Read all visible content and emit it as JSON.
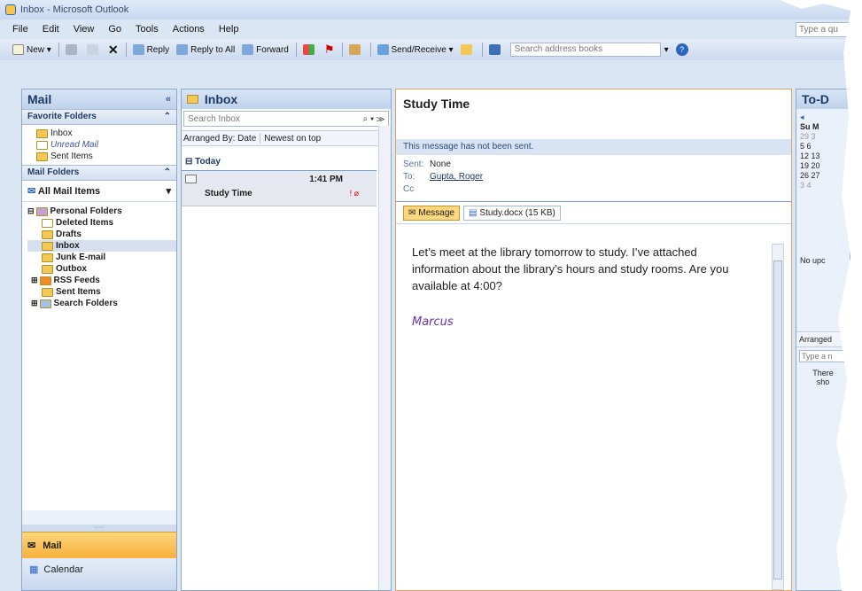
{
  "window": {
    "title": "Inbox - Microsoft Outlook"
  },
  "menu": [
    "File",
    "Edit",
    "View",
    "Go",
    "Tools",
    "Actions",
    "Help"
  ],
  "help_box": "Type a qu",
  "toolbar": {
    "new": "New",
    "reply": "Reply",
    "reply_all": "Reply to All",
    "forward": "Forward",
    "send_receive": "Send/Receive",
    "search_address": "Search address books"
  },
  "nav": {
    "title": "Mail",
    "collapse": "«",
    "favorites_header": "Favorite Folders",
    "favorites": [
      "Inbox",
      "Unread Mail",
      "Sent Items"
    ],
    "mail_folders_header": "Mail Folders",
    "all_mail": "All Mail Items",
    "root": "Personal Folders",
    "folders": [
      "Deleted Items",
      "Drafts",
      "Inbox",
      "Junk E-mail",
      "Outbox",
      "RSS Feeds",
      "Sent Items",
      "Search Folders"
    ],
    "mail_button": "Mail",
    "calendar_button": "Calendar"
  },
  "inbox": {
    "title": "Inbox",
    "search_placeholder": "Search Inbox",
    "arranged_by": "Arranged By: Date",
    "sort": "Newest on top",
    "group": "Today",
    "message": {
      "time": "1:41 PM",
      "subject": "Study Time"
    }
  },
  "reading": {
    "subject": "Study Time",
    "notice": "This message has not been sent.",
    "sent_label": "Sent:",
    "sent_value": "None",
    "to_label": "To:",
    "to_value": "Gupta, Roger",
    "cc_label": "Cc",
    "tab_message": "Message",
    "tab_attachment": "Study.docx (15 KB)",
    "body": "Let’s meet at the library tomorrow to study. I’ve attached information about the library’s hours and study rooms. Are you available at 4:00?",
    "signature": "Marcus"
  },
  "todo": {
    "title": "To-D",
    "cal_rows": [
      "Su M",
      "29  3",
      "5   6",
      "12 13",
      "19 20",
      "26 27",
      "3   4"
    ],
    "no_upcoming": "No upc",
    "arranged": "Arranged",
    "type_a": "Type a n",
    "there": "There",
    "sho": "sho"
  }
}
